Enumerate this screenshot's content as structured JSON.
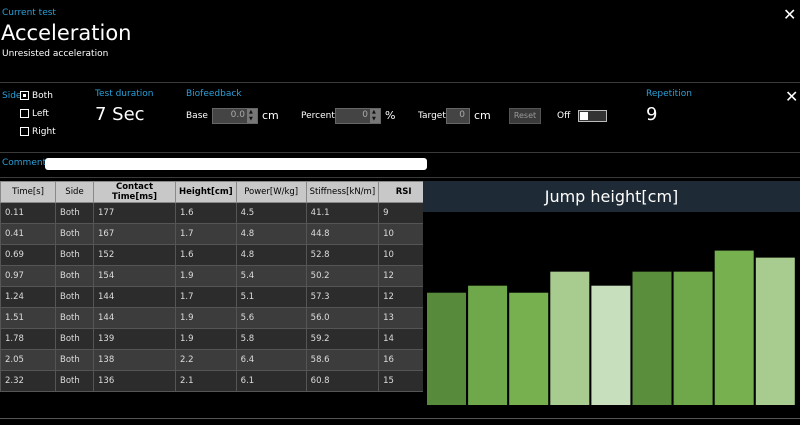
{
  "header": {
    "kicker": "Current test",
    "title": "Acceleration",
    "subtitle": "Unresisted acceleration"
  },
  "settings": {
    "side_label": "Side",
    "side_options": [
      {
        "label": "Both",
        "checked": true
      },
      {
        "label": "Left",
        "checked": false
      },
      {
        "label": "Right",
        "checked": false
      }
    ],
    "duration_label": "Test duration",
    "duration_value": "7 Sec",
    "biofeedback_label": "Biofeedback",
    "base_label": "Base",
    "base_value": "0.0",
    "base_unit": "cm",
    "percent_label": "Percent",
    "percent_value": "0",
    "percent_unit": "%",
    "target_label": "Target",
    "target_value": "0",
    "target_unit": "cm",
    "reset_label": "Reset",
    "toggle_label": "Off",
    "repetition_label": "Repetition",
    "repetition_value": "9"
  },
  "comment": {
    "label": "Comment:",
    "value": ""
  },
  "table": {
    "columns": [
      "Time[s]",
      "Side",
      "Contact Time[ms]",
      "Height[cm]",
      "Power[W/kg]",
      "Stiffness[kN/m]",
      "RSI"
    ],
    "rows": [
      [
        "0.11",
        "Both",
        "177",
        "1.6",
        "4.5",
        "41.1",
        "9"
      ],
      [
        "0.41",
        "Both",
        "167",
        "1.7",
        "4.8",
        "44.8",
        "10"
      ],
      [
        "0.69",
        "Both",
        "152",
        "1.6",
        "4.8",
        "52.8",
        "10"
      ],
      [
        "0.97",
        "Both",
        "154",
        "1.9",
        "5.4",
        "50.2",
        "12"
      ],
      [
        "1.24",
        "Both",
        "144",
        "1.7",
        "5.1",
        "57.3",
        "12"
      ],
      [
        "1.51",
        "Both",
        "144",
        "1.9",
        "5.6",
        "56.0",
        "13"
      ],
      [
        "1.78",
        "Both",
        "139",
        "1.9",
        "5.8",
        "59.2",
        "14"
      ],
      [
        "2.05",
        "Both",
        "138",
        "2.2",
        "6.4",
        "58.6",
        "16"
      ],
      [
        "2.32",
        "Both",
        "136",
        "2.1",
        "6.1",
        "60.8",
        "15"
      ]
    ]
  },
  "chart_data": {
    "type": "bar",
    "title": "Jump height[cm]",
    "values": [
      1.6,
      1.7,
      1.6,
      1.9,
      1.7,
      1.9,
      1.9,
      2.2,
      2.1
    ],
    "colors": [
      "#578a3a",
      "#6ea84a",
      "#77b04f",
      "#a8cc8f",
      "#c8dfbd",
      "#5a8e3c",
      "#6ea84a",
      "#77b04f",
      "#a8cc8f"
    ],
    "ylim": [
      0,
      2.75
    ]
  }
}
